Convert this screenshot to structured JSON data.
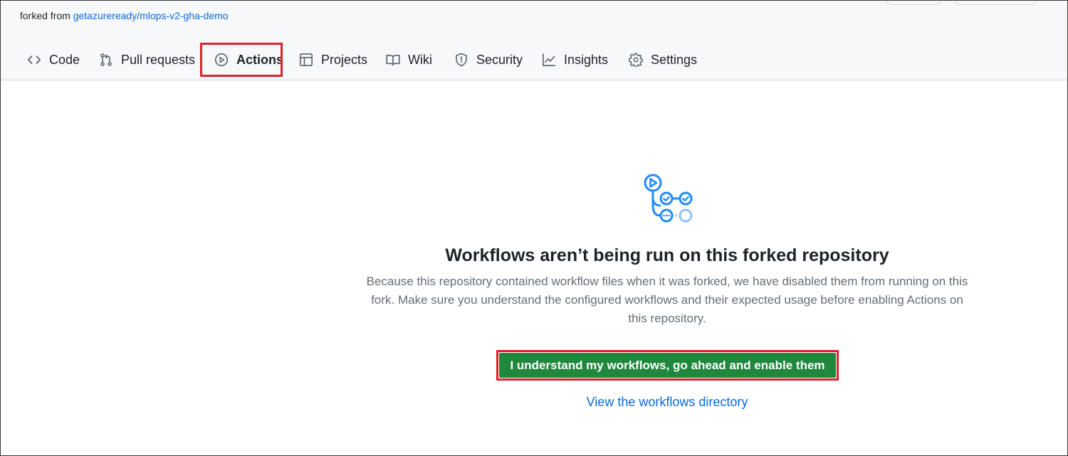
{
  "repo": {
    "forked_prefix": "forked from",
    "forked_link": "getazureready/mlops-v2-gha-demo"
  },
  "tabs": [
    {
      "label": "Code",
      "icon": "code-icon"
    },
    {
      "label": "Pull requests",
      "icon": "pull-request-icon"
    },
    {
      "label": "Actions",
      "icon": "play-icon",
      "active": true
    },
    {
      "label": "Projects",
      "icon": "table-icon"
    },
    {
      "label": "Wiki",
      "icon": "book-icon"
    },
    {
      "label": "Security",
      "icon": "shield-icon"
    },
    {
      "label": "Insights",
      "icon": "graph-icon"
    },
    {
      "label": "Settings",
      "icon": "gear-icon"
    }
  ],
  "main": {
    "illustration_icon": "workflow-icon",
    "headline": "Workflows aren’t being run on this forked repository",
    "description": "Because this repository contained workflow files when it was forked, we have disabled them from running on this fork. Make sure you understand the configured workflows and their expected usage before enabling Actions on this repository.",
    "enable_button": "I understand my workflows, go ahead and enable them",
    "view_link": "View the workflows directory"
  },
  "colors": {
    "accent_link": "#0969da",
    "primary_button": "#1f883d",
    "highlight": "#e0202a",
    "workflow_icon": "#218bff"
  }
}
